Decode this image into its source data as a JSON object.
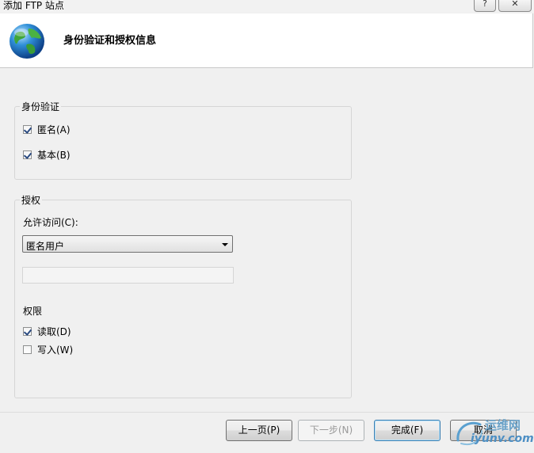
{
  "window": {
    "title": "添加 FTP 站点",
    "help_label": "?",
    "close_label": "✕"
  },
  "header": {
    "title": "身份验证和授权信息",
    "icon": "globe-icon"
  },
  "authentication": {
    "legend": "身份验证",
    "anonymous_label": "匿名(A)",
    "anonymous_checked": true,
    "basic_label": "基本(B)",
    "basic_checked": true
  },
  "authorization": {
    "legend": "授权",
    "allow_access_label": "允许访问(C):",
    "allow_access_value": "匿名用户",
    "user_input_value": "",
    "permissions_label": "权限",
    "read_label": "读取(D)",
    "read_checked": true,
    "write_label": "写入(W)",
    "write_checked": false
  },
  "footer": {
    "prev_label": "上一页(P)",
    "next_label": "下一步(N)",
    "finish_label": "完成(F)",
    "cancel_label": "取消"
  },
  "watermark": {
    "cn": "运维网",
    "en": "iyunv.com"
  },
  "colors": {
    "background": "#f0f0f0",
    "header_bg": "#ffffff",
    "primary_border": "#3c7fb1"
  }
}
